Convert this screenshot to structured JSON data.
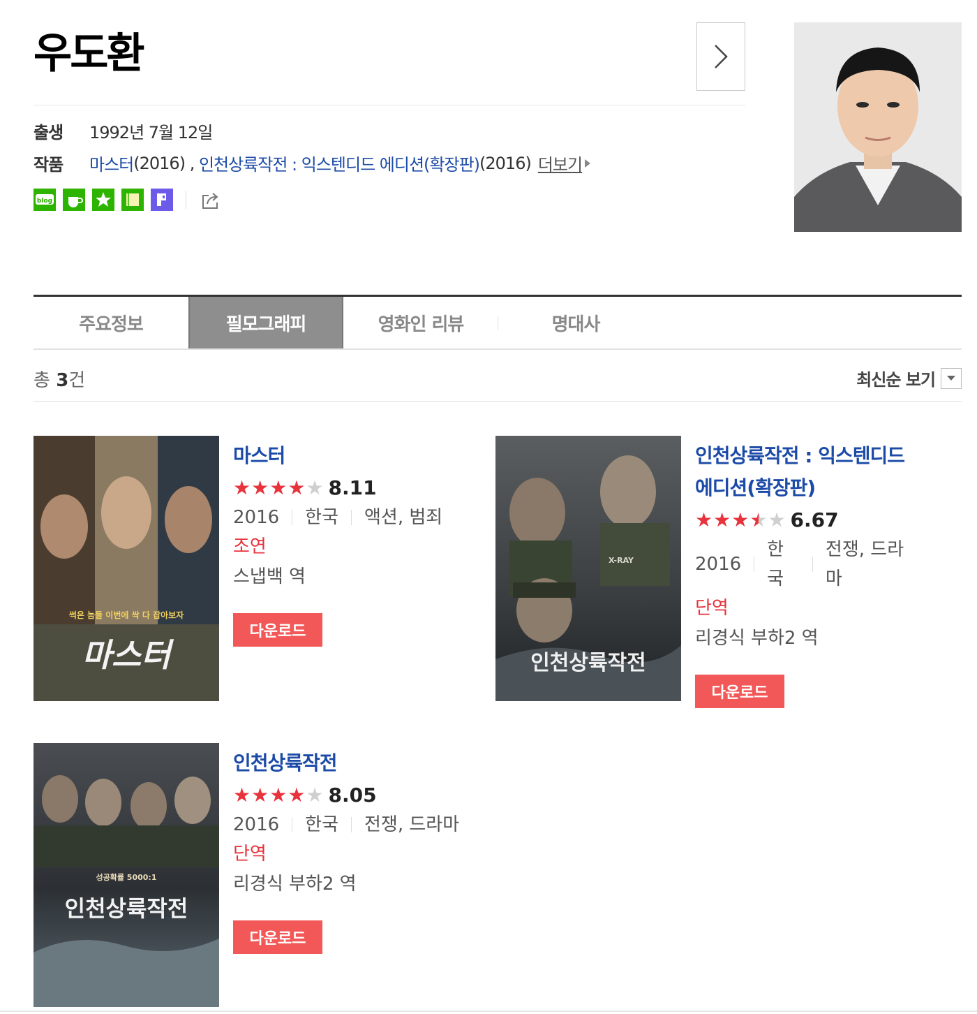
{
  "person": {
    "name": "우도환",
    "birth_label": "출생",
    "birth_value": "1992년 7월 12일",
    "works_label": "작품",
    "work1": "마스터",
    "work1_year": "(2016)",
    "comma": " , ",
    "work2": "인천상륙작전 : 익스텐디드 에디션(확장판)",
    "work2_year": "(2016)",
    "more_label": "더보기"
  },
  "share": {
    "icons": [
      "blog-icon",
      "cafe-icon",
      "star-icon",
      "memo-icon",
      "post-icon",
      "share-icon"
    ],
    "blog_text": "blog"
  },
  "tabs": [
    {
      "label": "주요정보",
      "active": false
    },
    {
      "label": "필모그래피",
      "active": true
    },
    {
      "label": "영화인 리뷰",
      "active": false
    },
    {
      "label": "명대사",
      "active": false
    }
  ],
  "list": {
    "total_prefix": "총 ",
    "total_count": "3",
    "total_suffix": "건",
    "sort_label": "최신순 보기"
  },
  "movies": [
    {
      "title": "마스터",
      "stars": 4,
      "score": "8.11",
      "year": "2016",
      "country": "한국",
      "genre": "액션, 범죄",
      "role": "조연",
      "character": "스냅백 역",
      "download": "다운로드",
      "poster_text": "마스터",
      "poster_tagline": "썩은 놈들 이번에 싹 다 잡아보자"
    },
    {
      "title": "인천상륙작전 : 익스텐디드 에디션(확장판)",
      "stars": 3.5,
      "score": "6.67",
      "year": "2016",
      "country": "한국",
      "genre": "전쟁, 드라마",
      "role": "단역",
      "character": "리경식 부하2 역",
      "download": "다운로드",
      "poster_text": "인천상륙작전",
      "poster_tagline": "X-RAY"
    },
    {
      "title": "인천상륙작전",
      "stars": 4,
      "score": "8.05",
      "year": "2016",
      "country": "한국",
      "genre": "전쟁, 드라마",
      "role": "단역",
      "character": "리경식 부하2 역",
      "download": "다운로드",
      "poster_text": "인천상륙작전",
      "poster_tagline": "성공확률 5000:1"
    }
  ],
  "colors": {
    "link": "#1c4ba7",
    "accent_red": "#e8323c",
    "download_bg": "#f25858",
    "active_tab": "#8e8e8e"
  }
}
